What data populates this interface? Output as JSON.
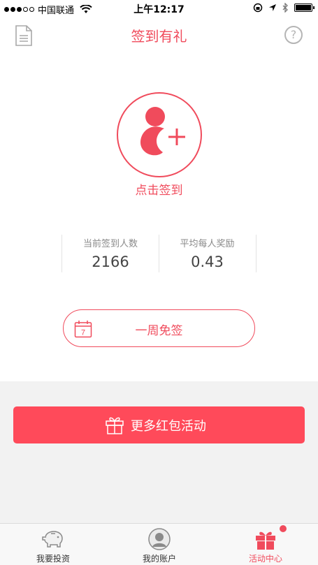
{
  "status_bar": {
    "carrier": "中国联通",
    "time": "上午12:17"
  },
  "header": {
    "title": "签到有礼",
    "help_label": "?"
  },
  "sign_in": {
    "label": "点击签到"
  },
  "stats": [
    {
      "label": "当前签到人数",
      "value": "2166"
    },
    {
      "label": "平均每人奖励",
      "value": "0.43"
    }
  ],
  "week_card": {
    "calendar_day": "7",
    "label": "一周免签"
  },
  "more_button": {
    "label": "更多红包活动"
  },
  "tabbar": {
    "tabs": [
      {
        "label": "我要投资",
        "icon": "piggy-bank-icon",
        "active": false
      },
      {
        "label": "我的账户",
        "icon": "user-avatar-icon",
        "active": false
      },
      {
        "label": "活动中心",
        "icon": "gift-icon",
        "active": true
      }
    ]
  },
  "colors": {
    "accent": "#f04b5c",
    "button_bg": "#ff4a5a",
    "section_bg": "#f2f2f2"
  }
}
